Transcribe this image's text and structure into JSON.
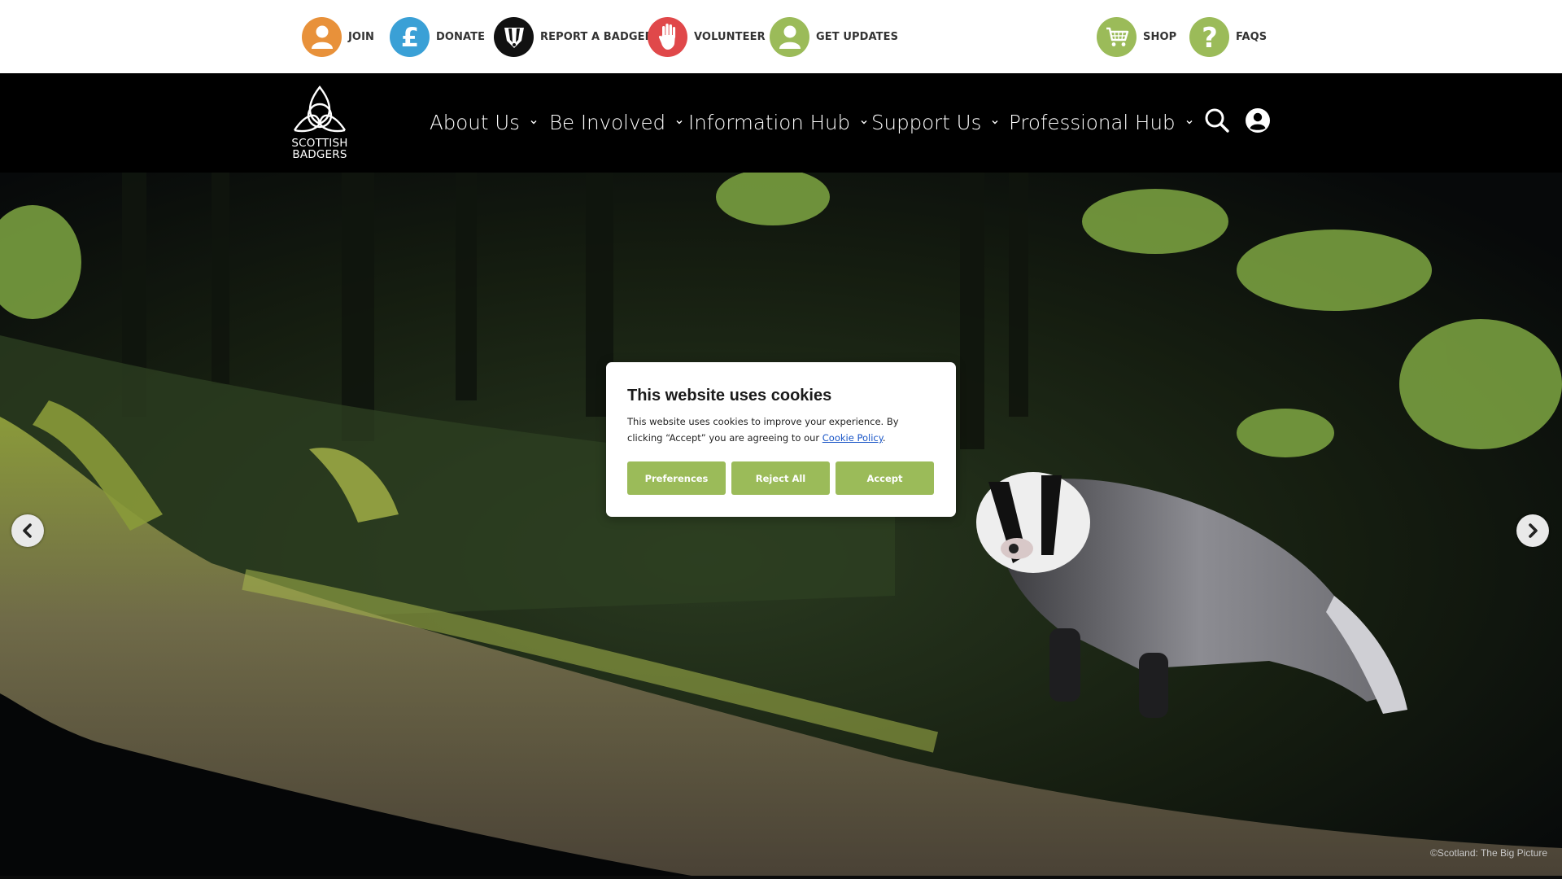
{
  "utility_bar": {
    "items": [
      {
        "label": "JOIN",
        "icon": "person-icon",
        "color": "#e8913a"
      },
      {
        "label": "DONATE",
        "icon": "pound-icon",
        "color": "#3aa0d6"
      },
      {
        "label": "REPORT A BADGER",
        "icon": "badger-head-icon",
        "color": "#111111"
      },
      {
        "label": "VOLUNTEER",
        "icon": "raised-hand-icon",
        "color": "#e0484a"
      },
      {
        "label": "GET UPDATES",
        "icon": "person-icon",
        "color": "#9bbb59"
      },
      {
        "label": "SHOP",
        "icon": "shopping-cart-icon",
        "color": "#9bbb59"
      },
      {
        "label": "FAQS",
        "icon": "question-mark-icon",
        "color": "#9bbb59"
      }
    ]
  },
  "logo": {
    "line1": "SCOTTISH",
    "line2": "BADGERS"
  },
  "nav": {
    "items": [
      "About Us",
      "Be Involved",
      "Information Hub",
      "Support Us",
      "Professional Hub"
    ],
    "search_icon": "search-icon",
    "account_icon": "account-icon"
  },
  "hero": {
    "photo_credit": "©Scotland: The Big Picture",
    "prev_icon": "chevron-left-icon",
    "next_icon": "chevron-right-icon"
  },
  "cookie": {
    "title": "This website uses cookies",
    "body_prefix": "This website uses cookies to improve your experience. By clicking “Accept” you are agreeing to our ",
    "link_text": "Cookie Policy",
    "body_suffix": ".",
    "buttons": {
      "preferences": "Preferences",
      "reject": "Reject All",
      "accept": "Accept"
    },
    "button_color": "#9bbb59"
  }
}
